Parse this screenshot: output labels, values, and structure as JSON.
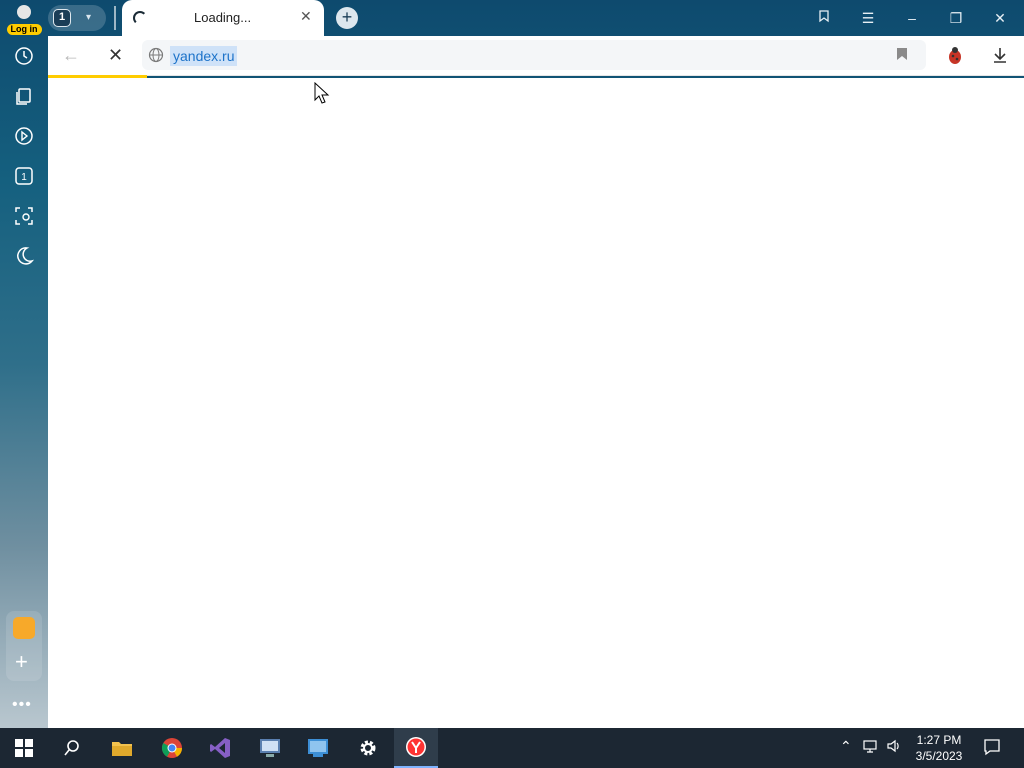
{
  "browser": {
    "profile": {
      "login_label": "Log in"
    },
    "tab_counter": {
      "count": "1"
    },
    "active_tab": {
      "title": "Loading..."
    },
    "address_bar": {
      "url": "yandex.ru"
    },
    "colors": {
      "accent": "#ffcc00",
      "url_highlight": "#cfe2f8"
    },
    "icons": {
      "sidebar": [
        "history-icon",
        "collections-icon",
        "play-icon",
        "tab-counter-icon",
        "screenshot-icon",
        "night-mode-icon",
        "mail-icon",
        "add-icon",
        "more-icon"
      ],
      "toolbar": [
        "back-icon",
        "stop-icon",
        "globe-icon",
        "bookmark-icon",
        "extension-icon",
        "download-icon"
      ],
      "window": [
        "collections-icon",
        "menu-icon",
        "minimize-icon",
        "restore-icon",
        "close-icon"
      ]
    }
  },
  "taskbar": {
    "icons": [
      "windows-start-icon",
      "search-icon",
      "file-explorer-icon",
      "chrome-icon",
      "visual-studio-icon",
      "network-manager-icon",
      "remote-desktop-icon",
      "settings-icon",
      "yandex-browser-icon"
    ],
    "clock": {
      "time": "1:27 PM",
      "date": "3/5/2023"
    }
  }
}
